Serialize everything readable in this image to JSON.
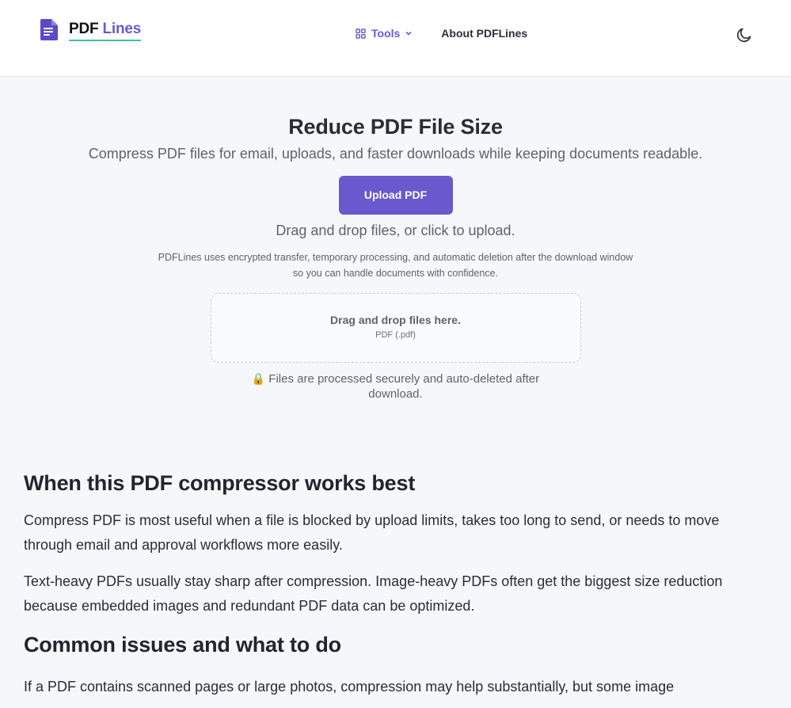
{
  "header": {
    "logo": {
      "part1": "PDF",
      "part2": "Lines",
      "icon": "document-icon"
    },
    "nav": {
      "tools_label": "Tools",
      "about_label": "About PDFLines"
    },
    "theme_icon": "moon-icon"
  },
  "hero": {
    "title": "Reduce PDF File Size",
    "subtitle": "Compress PDF files for email, uploads, and faster downloads while keeping documents readable.",
    "upload_button": "Upload PDF",
    "drag_text": "Drag and drop files, or click to upload.",
    "privacy_line1": "PDFLines uses encrypted transfer, temporary processing, and automatic deletion after the download window",
    "privacy_line2": "so you can handle documents with confidence.",
    "dropzone_title": "Drag and drop files here.",
    "dropzone_format": "PDF (.pdf)",
    "secure_note": "Files are processed securely and auto-deleted after download."
  },
  "content": {
    "h1": "When this PDF compressor works best",
    "p1": "Compress PDF is most useful when a file is blocked by upload limits, takes too long to send, or needs to move through email and approval workflows more easily.",
    "p2": "Text-heavy PDFs usually stay sharp after compression. Image-heavy PDFs often get the biggest size reduction because embedded images and redundant PDF data can be optimized.",
    "h2": "Common issues and what to do",
    "p3": "If a PDF contains scanned pages or large photos, compression may help substantially, but some image"
  },
  "colors": {
    "accent": "#6a58cf",
    "underline": "#3ec19a",
    "page_bg": "#f6f7fb"
  }
}
